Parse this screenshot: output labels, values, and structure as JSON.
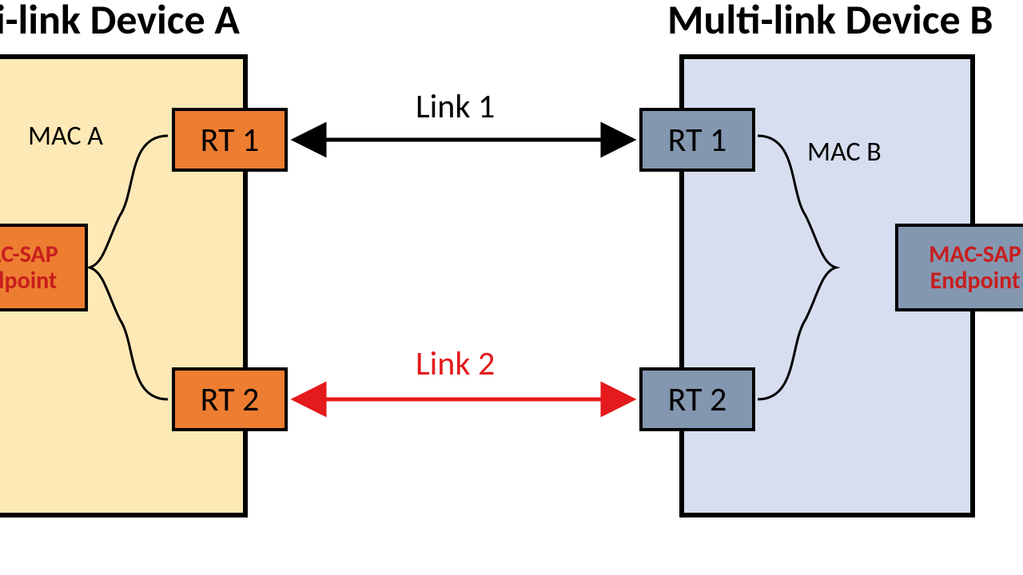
{
  "titles": {
    "deviceA": "Multi-link Device A",
    "deviceB": "Multi-link Device B"
  },
  "deviceA": {
    "mac_label": "MAC A",
    "endpoint_line1": "MAC-SAP",
    "endpoint_line2": "Endpoint",
    "rt1": "RT 1",
    "rt2": "RT 2",
    "colors": {
      "fill": "#fde9b6",
      "rt_fill": "#ed7d31",
      "endpoint_fill": "#ed7d31"
    }
  },
  "deviceB": {
    "mac_label": "MAC B",
    "endpoint_line1": "MAC-SAP",
    "endpoint_line2": "Endpoint",
    "rt1": "RT 1",
    "rt2": "RT 2",
    "colors": {
      "fill": "#d6deef",
      "rt_fill": "#8497b0",
      "endpoint_fill": "#8497b0"
    }
  },
  "links": {
    "link1": {
      "label": "Link 1",
      "color": "#000000"
    },
    "link2": {
      "label": "Link 2",
      "color": "#e41a1c"
    }
  }
}
